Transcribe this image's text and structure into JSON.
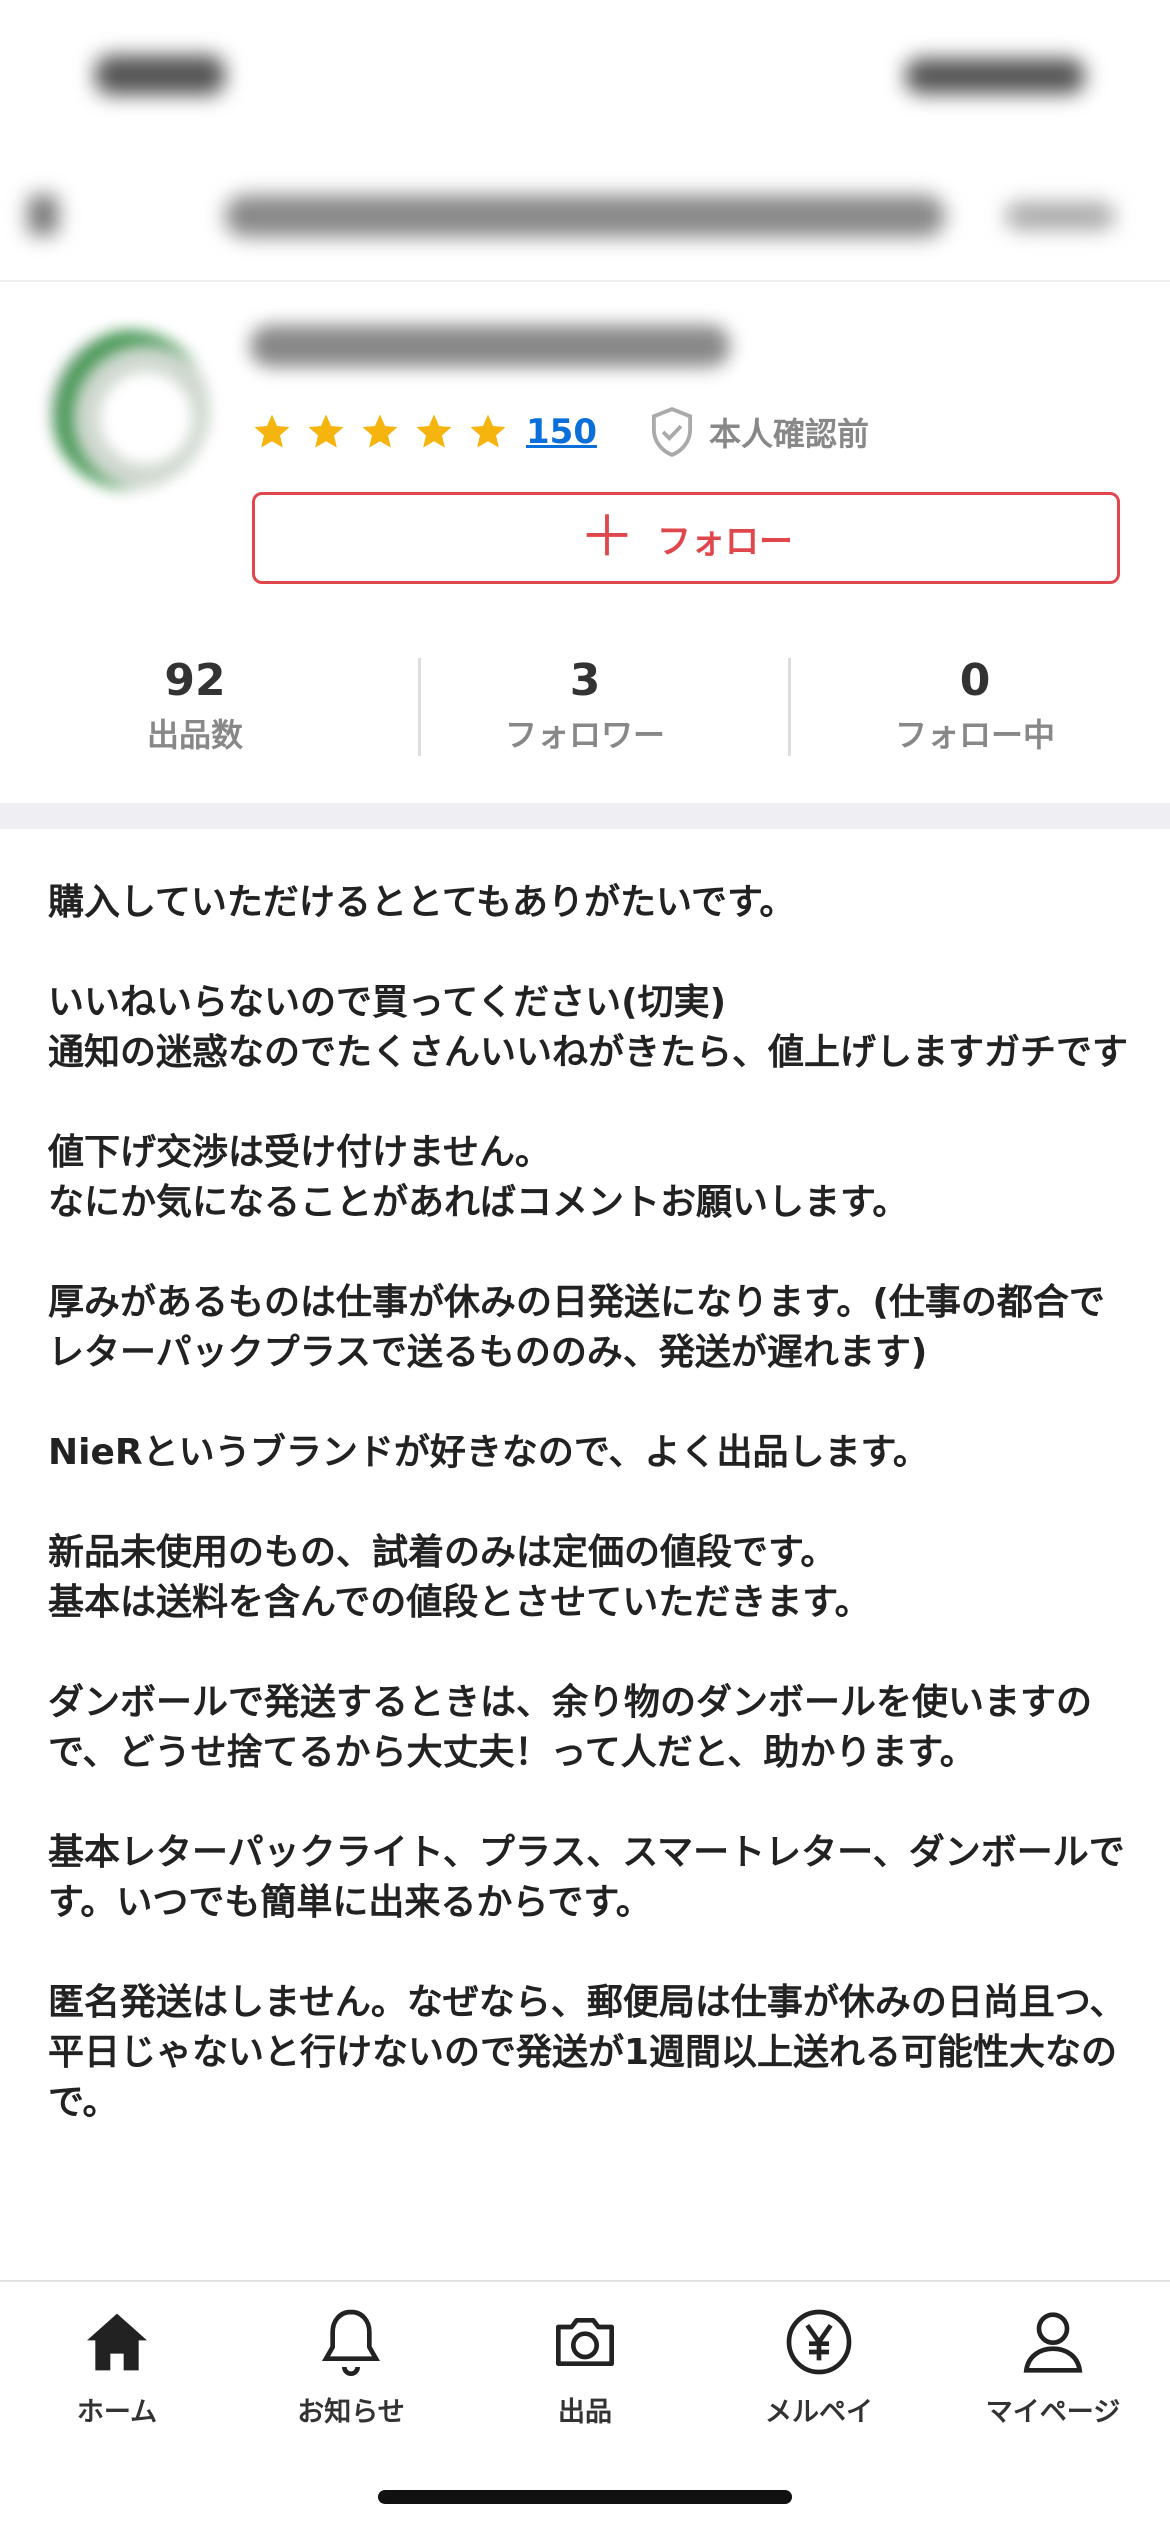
{
  "profile": {
    "rating_stars": 5,
    "review_count": "150",
    "verification_status": "本人確認前",
    "follow_button": {
      "label": "フォロー",
      "icon": "plus-icon"
    }
  },
  "stats": [
    {
      "value": "92",
      "label": "出品数"
    },
    {
      "value": "3",
      "label": "フォロワー"
    },
    {
      "value": "0",
      "label": "フォロー中"
    }
  ],
  "bio": [
    "購入していただけるととてもありがたいです。",
    "いいねいらないので買ってください(切実)\n通知の迷惑なのでたくさんいいねがきたら、値上げしますガチです",
    "値下げ交渉は受け付けません。\nなにか気になることがあればコメントお願いします。",
    "厚みがあるものは仕事が休みの日発送になります。(仕事の都合でレターパックプラスで送るもののみ、発送が遅れます)",
    "NieRというブランドが好きなので、よく出品します。",
    "新品未使用のもの、試着のみは定価の値段です。\n基本は送料を含んでの値段とさせていただきます。",
    "ダンボールで発送するときは、余り物のダンボールを使いますので、どうせ捨てるから大丈夫！って人だと、助かります。",
    "基本レターパックライト、プラス、スマートレター、ダンボールです。いつでも簡単に出来るからです。",
    "匿名発送はしません。なぜなら、郵便局は仕事が休みの日尚且つ、平日じゃないと行けないので発送が1週間以上送れる可能性大なので。"
  ],
  "tabbar": [
    {
      "label": "ホーム",
      "icon": "home-icon"
    },
    {
      "label": "お知らせ",
      "icon": "bell-icon"
    },
    {
      "label": "出品",
      "icon": "camera-icon"
    },
    {
      "label": "メルペイ",
      "icon": "yen-icon"
    },
    {
      "label": "マイページ",
      "icon": "person-icon"
    }
  ],
  "colors": {
    "accent": "#e0474c",
    "star": "#f6b40e",
    "link": "#0a6fd8"
  }
}
